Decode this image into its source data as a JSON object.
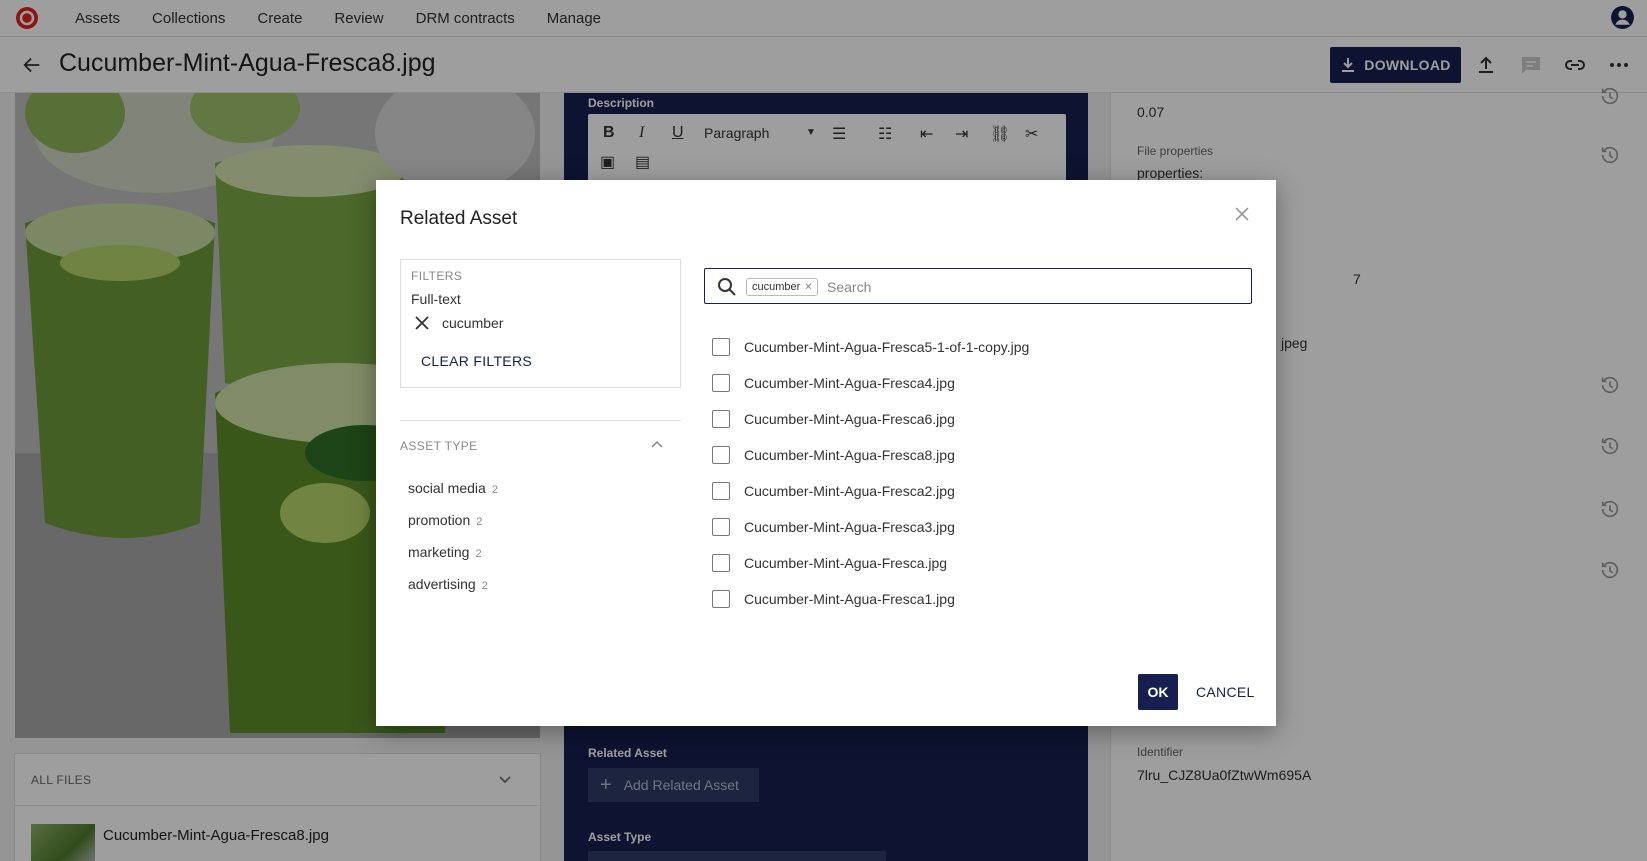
{
  "nav": {
    "items": [
      {
        "label": "Assets"
      },
      {
        "label": "Collections"
      },
      {
        "label": "Create"
      },
      {
        "label": "Review"
      },
      {
        "label": "DRM contracts"
      },
      {
        "label": "Manage"
      }
    ]
  },
  "header": {
    "title": "Cucumber-Mint-Agua-Fresca8.jpg",
    "download_label": "DOWNLOAD"
  },
  "files_panel": {
    "title": "ALL FILES",
    "file_name": "Cucumber-Mint-Agua-Fresca8.jpg"
  },
  "form": {
    "description_label": "Description",
    "paragraph_label": "Paragraph",
    "related_asset_label": "Related Asset",
    "add_related_label": "Add Related Asset",
    "asset_type_label": "Asset Type"
  },
  "side": {
    "top_value": "0.07",
    "file_properties_label": "File properties",
    "properties_text": "properties:",
    "partial_1": "7",
    "partial_2": "jpeg",
    "identifier_label": "Identifier",
    "identifier_value": "7lru_CJZ8Ua0fZtwWm695A"
  },
  "modal": {
    "title": "Related Asset",
    "filters_header": "FILTERS",
    "fulltext_label": "Full-text",
    "active_filter": "cucumber",
    "clear_filters_label": "CLEAR FILTERS",
    "asset_type_header": "ASSET TYPE",
    "facets": [
      {
        "label": "social media",
        "count": "2"
      },
      {
        "label": "promotion",
        "count": "2"
      },
      {
        "label": "marketing",
        "count": "2"
      },
      {
        "label": "advertising",
        "count": "2"
      }
    ],
    "search_tag": "cucumber",
    "search_placeholder": "Search",
    "results": [
      {
        "label": "Cucumber-Mint-Agua-Fresca5-1-of-1-copy.jpg"
      },
      {
        "label": "Cucumber-Mint-Agua-Fresca4.jpg"
      },
      {
        "label": "Cucumber-Mint-Agua-Fresca6.jpg"
      },
      {
        "label": "Cucumber-Mint-Agua-Fresca8.jpg"
      },
      {
        "label": "Cucumber-Mint-Agua-Fresca2.jpg"
      },
      {
        "label": "Cucumber-Mint-Agua-Fresca3.jpg"
      },
      {
        "label": "Cucumber-Mint-Agua-Fresca.jpg"
      },
      {
        "label": "Cucumber-Mint-Agua-Fresca1.jpg"
      }
    ],
    "ok_label": "OK",
    "cancel_label": "CANCEL"
  },
  "colors": {
    "brand_navy": "#152050",
    "logo_red": "#e0231d"
  }
}
